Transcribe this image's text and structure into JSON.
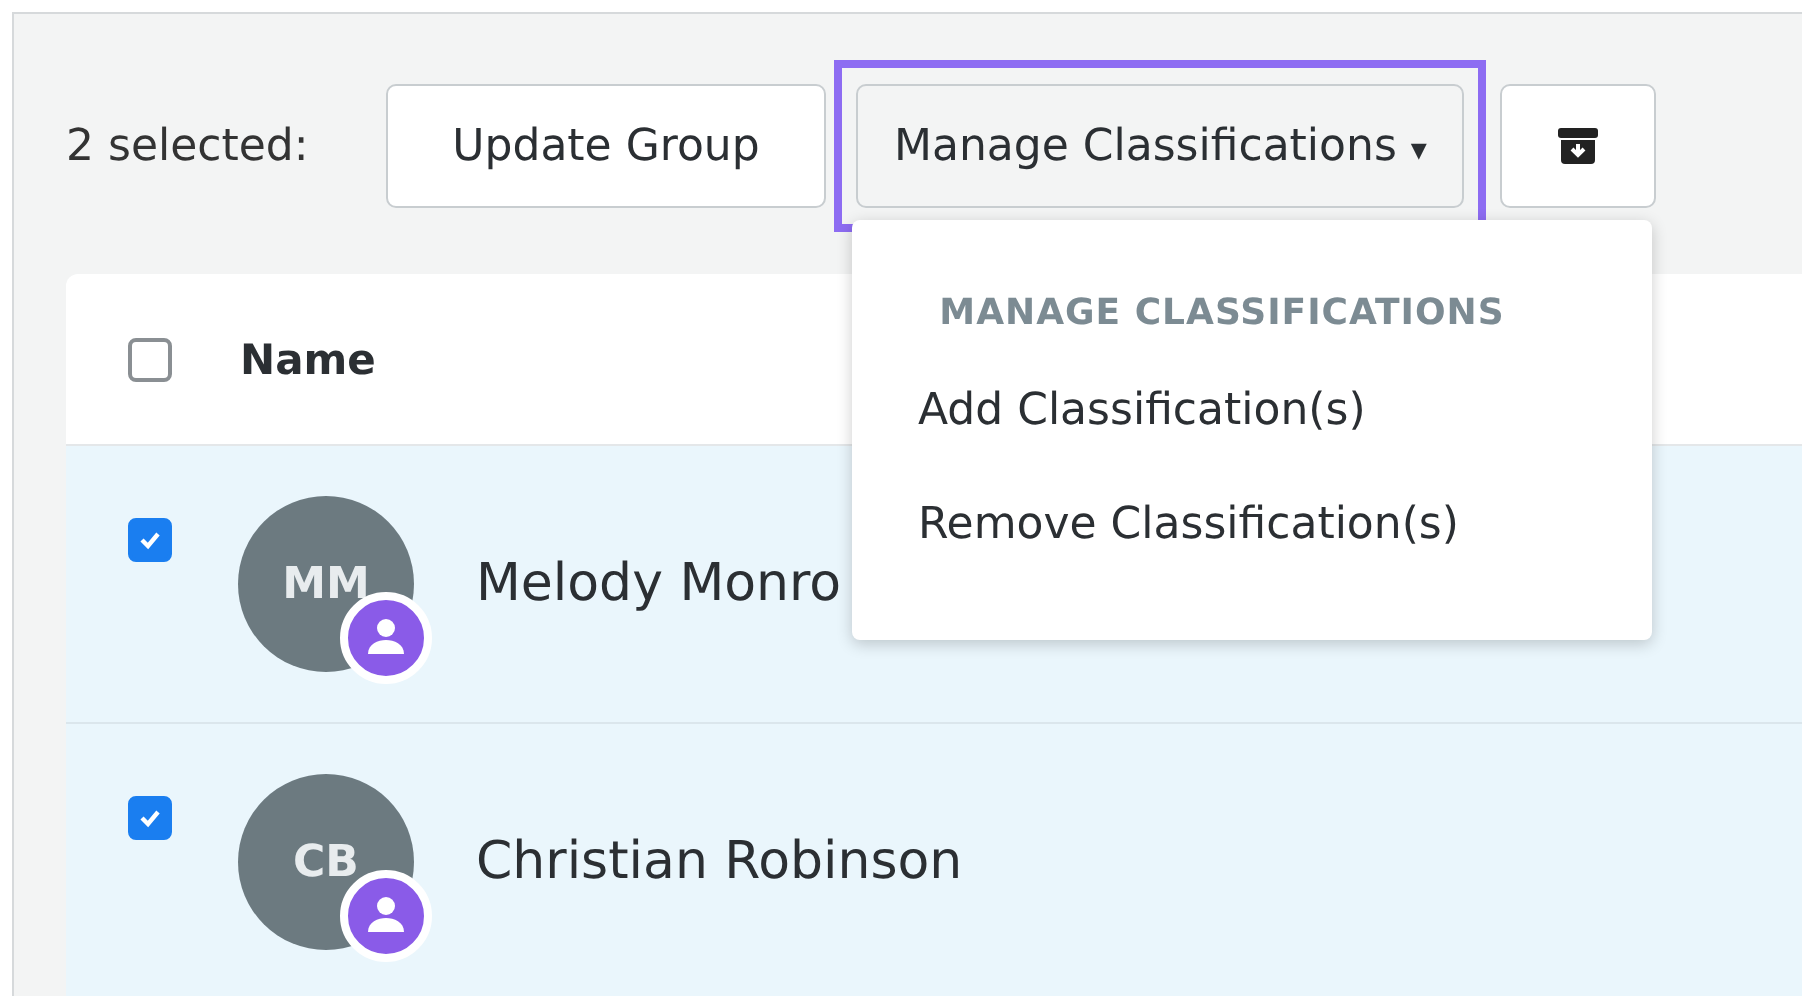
{
  "toolbar": {
    "selection_label": "2 selected:",
    "buttons": [
      {
        "kind": "plain",
        "label": "Update Group"
      },
      {
        "kind": "dropdown",
        "label": "Manage Classifications",
        "caret": "▾",
        "highlighted": true
      },
      {
        "kind": "icon"
      }
    ]
  },
  "dropdown_menu": {
    "header": "MANAGE CLASSIFICATIONS",
    "items": [
      "Add Classification(s)",
      "Remove Classification(s)"
    ]
  },
  "table": {
    "select_all_checked": false,
    "columns": [
      "Name"
    ],
    "rows": [
      {
        "checked": true,
        "initials": "MM",
        "name": "Melody Monro"
      },
      {
        "checked": true,
        "initials": "CB",
        "name": "Christian Robinson"
      }
    ]
  }
}
